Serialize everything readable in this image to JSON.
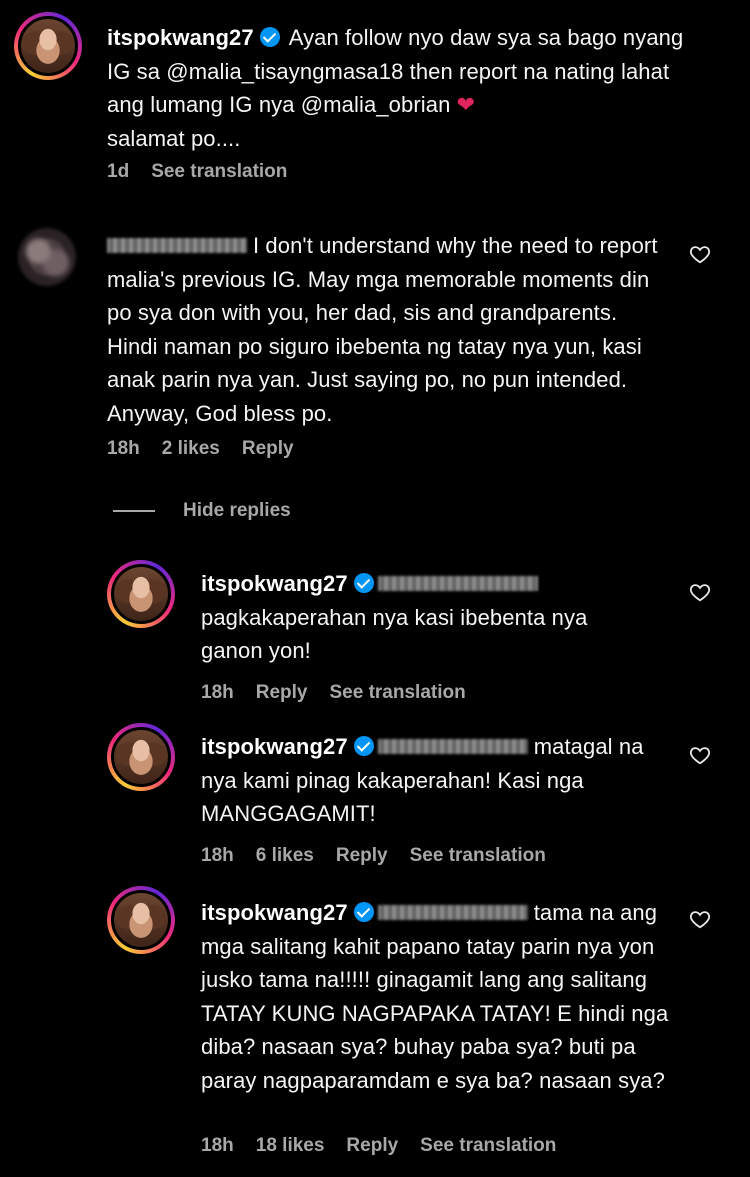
{
  "comments": [
    {
      "username": "itspokwang27",
      "text": "Ayan follow nyo daw sya sa bago nyang IG sa @malia_tisayngmasa18 then report na nating lahat ang lumang IG nya @malia_obrian",
      "heart_icon": "red-heart-emoji",
      "text_tail": "salamat po....",
      "time": "1d",
      "see_translation": "See translation"
    },
    {
      "text": "I don't understand why the need to report malia's previous IG. May mga memorable moments din po sya don with you, her dad, sis and grandparents. Hindi naman po siguro ibebenta ng tatay nya yun, kasi anak parin nya yan. Just saying po, no pun intended. Anyway, God bless po.",
      "time": "18h",
      "likes": "2 likes",
      "reply": "Reply"
    }
  ],
  "hide_replies": "Hide replies",
  "replies": [
    {
      "username": "itspokwang27",
      "text": "pagkakaperahan nya kasi ibebenta nya ganon yon!",
      "time": "18h",
      "reply": "Reply",
      "see_translation": "See translation"
    },
    {
      "username": "itspokwang27",
      "text": "matagal na nya kami pinag kakaperahan! Kasi nga MANGGAGAMIT!",
      "time": "18h",
      "likes": "6 likes",
      "reply": "Reply",
      "see_translation": "See translation"
    },
    {
      "username": "itspokwang27",
      "text": "tama na ang mga salitang kahit papano tatay parin nya yon jusko tama na!!!!! ginagamit lang ang salitang TATAY KUNG NAGPAPAKA TATAY! E hindi nga diba? nasaan sya? buhay paba sya? buti pa paray nagpaparamdam e sya ba? nasaan sya?",
      "time": "18h",
      "likes": "18 likes",
      "reply": "Reply",
      "see_translation": "See translation"
    }
  ],
  "colors": {
    "background": "#000000",
    "text": "#f5f5f5",
    "meta": "#a8a8a8",
    "verified": "#0095f6",
    "heart": "#e0245e"
  }
}
